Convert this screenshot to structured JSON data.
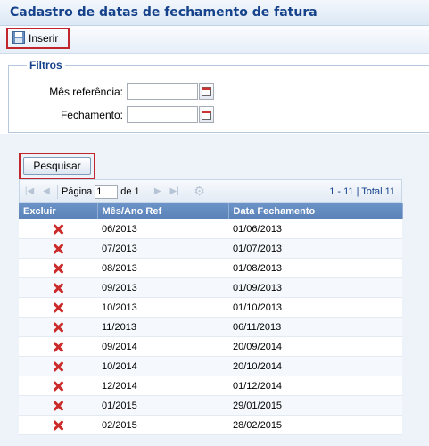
{
  "title": "Cadastro de datas de fechamento de fatura",
  "toolbar": {
    "inserir_label": "Inserir",
    "inserir_icon": "save-icon"
  },
  "filters": {
    "legend": "Filtros",
    "mes_label": "Mês referência:",
    "mes_value": "",
    "fechamento_label": "Fechamento:",
    "fechamento_value": ""
  },
  "search_label": "Pesquisar",
  "pager": {
    "page_label": "Página",
    "page_value": "1",
    "of_label": "de 1",
    "summary": "1 - 11 | Total 11"
  },
  "grid": {
    "columns": [
      "Excluir",
      "Mês/Ano Ref",
      "Data Fechamento"
    ],
    "rows": [
      [
        "06/2013",
        "01/06/2013"
      ],
      [
        "07/2013",
        "01/07/2013"
      ],
      [
        "08/2013",
        "01/08/2013"
      ],
      [
        "09/2013",
        "01/09/2013"
      ],
      [
        "10/2013",
        "01/10/2013"
      ],
      [
        "11/2013",
        "06/11/2013"
      ],
      [
        "09/2014",
        "20/09/2014"
      ],
      [
        "10/2014",
        "20/10/2014"
      ],
      [
        "12/2014",
        "01/12/2014"
      ],
      [
        "01/2015",
        "29/01/2015"
      ],
      [
        "02/2015",
        "28/02/2015"
      ]
    ]
  },
  "colors": {
    "accent": "#15428b",
    "highlight_border": "#c0262c",
    "delete": "#cc2b2b"
  }
}
